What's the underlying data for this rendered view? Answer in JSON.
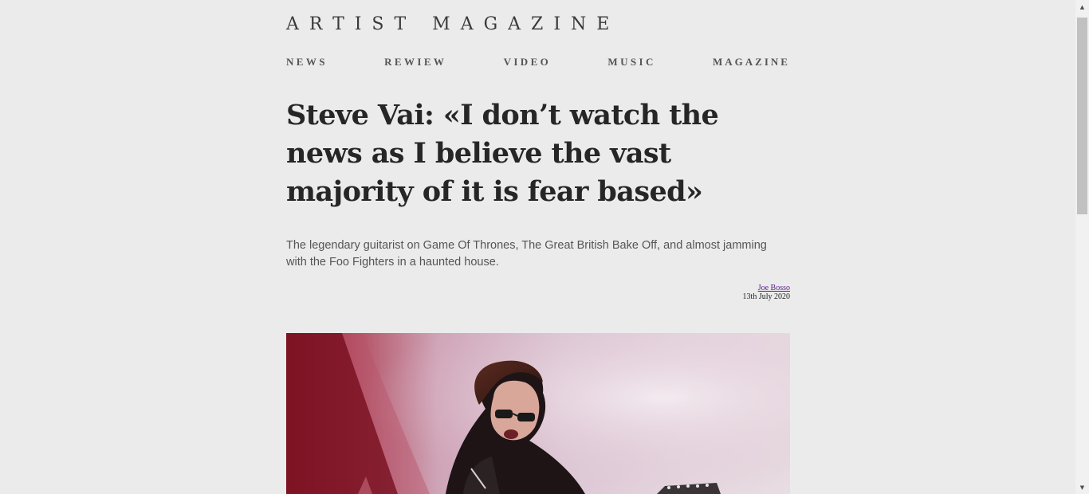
{
  "site": {
    "logo": "ARTIST MAGAZINE"
  },
  "nav": {
    "items": [
      {
        "label": "NEWS"
      },
      {
        "label": "REWIEW"
      },
      {
        "label": "VIDEO"
      },
      {
        "label": "MUSIC"
      },
      {
        "label": "MAGAZINE"
      }
    ]
  },
  "article": {
    "headline": "Steve Vai: «I don’t watch the news as I believe the vast majority of it is fear based»",
    "standfirst": "The legendary guitarist on Game Of Thrones, The Great British Bake Off, and almost jamming with the Foo Fighters in a haunted house.",
    "author": "Joe Bosso",
    "date": "13th July 2020",
    "hero_image": "photo of guitarist performing on stage"
  },
  "scrollbar": {
    "up_icon": "scroll-up-arrow-icon",
    "down_icon": "scroll-down-arrow-icon"
  },
  "colors": {
    "background": "#ebebeb",
    "headline": "#262626",
    "nav": "#555555",
    "author_link": "#551a8b"
  }
}
